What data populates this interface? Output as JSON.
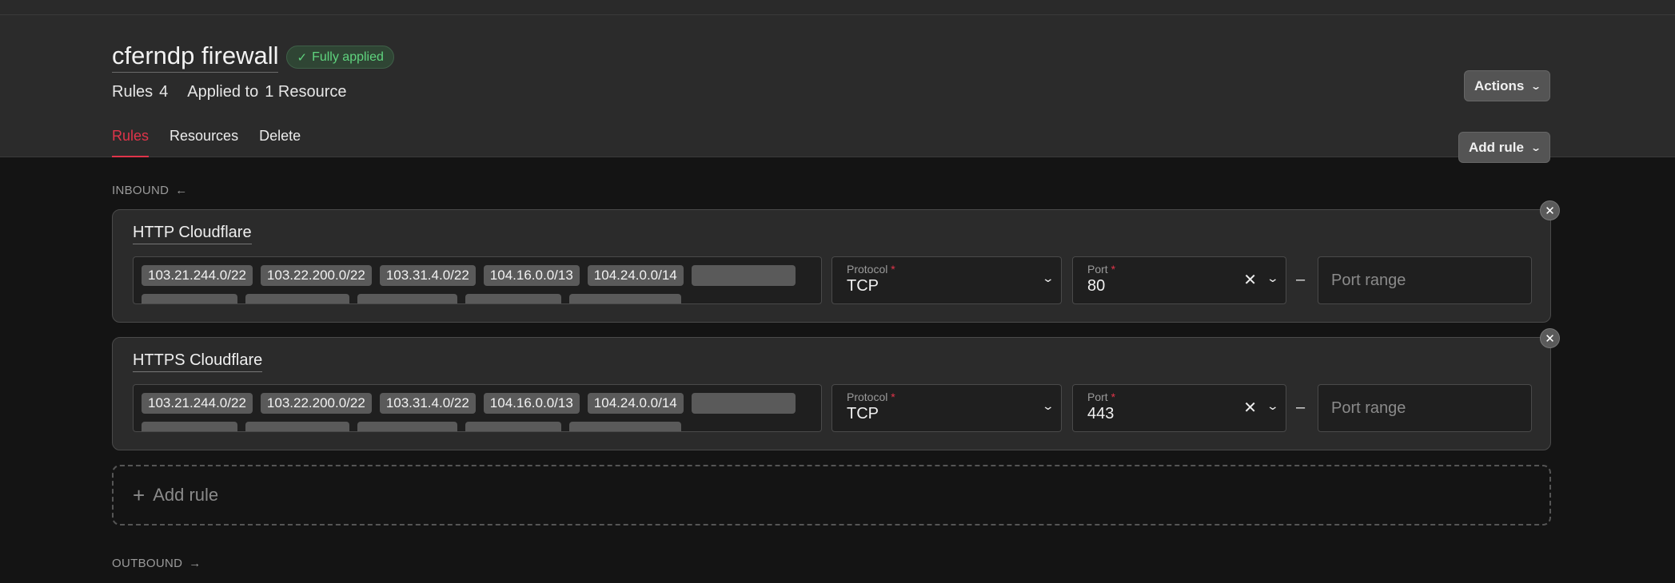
{
  "header": {
    "title": "cferndp firewall",
    "status_badge": "Fully applied",
    "rules_label": "Rules",
    "rules_count": "4",
    "applied_label": "Applied to",
    "applied_value": "1 Resource",
    "actions_label": "Actions",
    "add_rule_label": "Add rule",
    "tabs": [
      {
        "label": "Rules",
        "active": true
      },
      {
        "label": "Resources",
        "active": false
      },
      {
        "label": "Delete",
        "active": false
      }
    ]
  },
  "inbound": {
    "label": "INBOUND",
    "rules": [
      {
        "name": "HTTP Cloudflare",
        "ips": [
          "103.21.244.0/22",
          "103.22.200.0/22",
          "103.31.4.0/22",
          "104.16.0.0/13",
          "104.24.0.0/14"
        ],
        "protocol_label": "Protocol",
        "protocol": "TCP",
        "port_label": "Port",
        "port": "80",
        "port_range_placeholder": "Port range"
      },
      {
        "name": "HTTPS Cloudflare",
        "ips": [
          "103.21.244.0/22",
          "103.22.200.0/22",
          "103.31.4.0/22",
          "104.16.0.0/13",
          "104.24.0.0/14"
        ],
        "protocol_label": "Protocol",
        "protocol": "TCP",
        "port_label": "Port",
        "port": "443",
        "port_range_placeholder": "Port range"
      }
    ],
    "add_rule_label": "Add rule"
  },
  "outbound": {
    "label": "OUTBOUND"
  },
  "colors": {
    "accent": "#e0344a",
    "success": "#5fd47e",
    "background": "#141414",
    "panel": "#2b2b2b"
  }
}
